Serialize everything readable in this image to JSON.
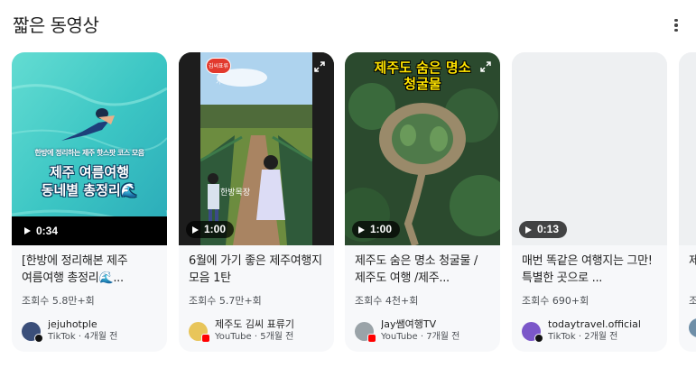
{
  "section": {
    "title": "짧은 동영상",
    "more_icon": "more-vert-icon"
  },
  "cards": [
    {
      "duration": "0:34",
      "title": "[한방에 정리해본 제주 여름여행 총정리🌊...",
      "views": "조회수 5.8만+회",
      "channel": "jejuhotple",
      "platform": "TikTok",
      "age": "4개월 전",
      "platform_meta": "TikTok · 4개월 전",
      "thumb_caption_small": "한방에 정리하는 제주 핫스팟 코스 모음",
      "thumb_caption_line1": "제주 여름여행",
      "thumb_caption_line2": "동네별 총정리🌊",
      "avatar_color": "#3b4f7a"
    },
    {
      "duration": "1:00",
      "title": "6월에 가기 좋은 제주여행지 모음 1탄",
      "views": "조회수 5.7만+회",
      "channel": "제주도 김씨 표류기",
      "platform": "YouTube",
      "age": "5개월 전",
      "platform_meta": "YouTube · 5개월 전",
      "thumb_logo": "김씨표류기",
      "thumb_sign": "한방목장",
      "avatar_color": "#e8c55a"
    },
    {
      "duration": "1:00",
      "title": "제주도 숨은 명소 청굴물 /제주도 여행 /제주...",
      "views": "조회수 4천+회",
      "channel": "Jay쌤여행TV",
      "platform": "YouTube",
      "age": "7개월 전",
      "platform_meta": "YouTube · 7개월 전",
      "thumb_caption_line1": "제주도 숨은 명소",
      "thumb_caption_line2": "청굴물",
      "avatar_color": "#9aa3a8"
    },
    {
      "duration": "0:13",
      "title": "매번 똑같은 여행지는 그만! 특별한 곳으로 ...",
      "views": "조회수 690+회",
      "channel": "todaytravel.official",
      "platform": "TikTok",
      "age": "2개월 전",
      "platform_meta": "TikTok · 2개월 전",
      "avatar_color": "#7b57c9"
    },
    {
      "title": "제주 제주",
      "views": "조회수",
      "avatar_color": "#6f8fa8"
    }
  ],
  "colors": {
    "card_bg": "#f7f8fa",
    "secondary_text": "#4d5156",
    "youtube_red": "#ff0000"
  }
}
